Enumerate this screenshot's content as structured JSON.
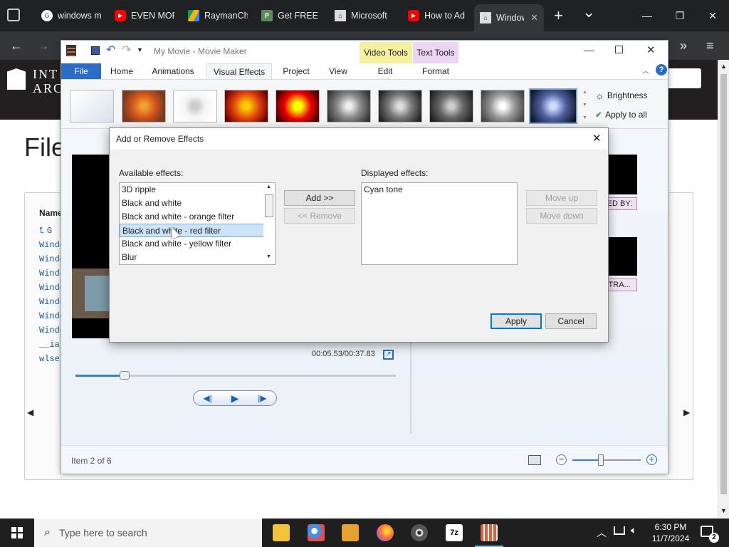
{
  "browser": {
    "tabs": [
      {
        "label": "windows m",
        "icon": "google-icon",
        "color": "#4285f4"
      },
      {
        "label": "EVEN MOR",
        "icon": "youtube-icon",
        "color": "#ff0000"
      },
      {
        "label": "RaymanCh",
        "icon": "drive-icon",
        "color": "#f4b400"
      },
      {
        "label": "Get FREE M",
        "icon": "p-icon",
        "color": "#5b8c5a"
      },
      {
        "label": "Microsoft",
        "icon": "archive-icon",
        "color": "#dddddd"
      },
      {
        "label": "How to Ad",
        "icon": "youtube-icon",
        "color": "#ff0000"
      },
      {
        "label": "Window",
        "icon": "archive-icon",
        "color": "#dddddd"
      }
    ],
    "new_tab": "+",
    "tab_search": "⌄"
  },
  "webpage": {
    "logo_line1": "INT",
    "logo_line2": "ARC",
    "title": "File",
    "name_header": "Name",
    "parent_link": "G",
    "files": [
      "Windo",
      "Windo",
      "Windo",
      "Windo",
      "Windo",
      "Windo",
      "Windo",
      "__ia_",
      "wlset"
    ]
  },
  "moviemaker": {
    "title": "My Movie - Movie Maker",
    "context_video": "Video Tools",
    "context_text": "Text Tools",
    "tabs": {
      "file": "File",
      "home": "Home",
      "animations": "Animations",
      "visual_effects": "Visual Effects",
      "project": "Project",
      "view": "View",
      "edit": "Edit",
      "format": "Format"
    },
    "brightness": "Brightness",
    "apply_all": "Apply to all",
    "timecode": "00:05.53/00:37.83",
    "status_item": "Item 2 of 6",
    "right_label1": "TED BY:",
    "right_label2": "OTRA...",
    "colors": {
      "file_tab": "#2b6cc4",
      "video_tools": "#f5f0a0",
      "text_tools": "#ecd5f5"
    }
  },
  "dialog": {
    "title": "Add or Remove Effects",
    "available_label": "Available effects:",
    "displayed_label": "Displayed effects:",
    "available": [
      "3D ripple",
      "Black and white",
      "Black and white - orange filter",
      "Black and white - red filter",
      "Black and white - yellow filter",
      "Blur"
    ],
    "selected_index": 3,
    "displayed": [
      "Cyan tone"
    ],
    "add_label": "Add >>",
    "remove_label": "<< Remove",
    "move_up_label": "Move up",
    "move_down_label": "Move down",
    "apply_label": "Apply",
    "cancel_label": "Cancel"
  },
  "taskbar": {
    "search_placeholder": "Type here to search",
    "time": "6:30 PM",
    "date": "11/7/2024",
    "notifications": "2"
  }
}
